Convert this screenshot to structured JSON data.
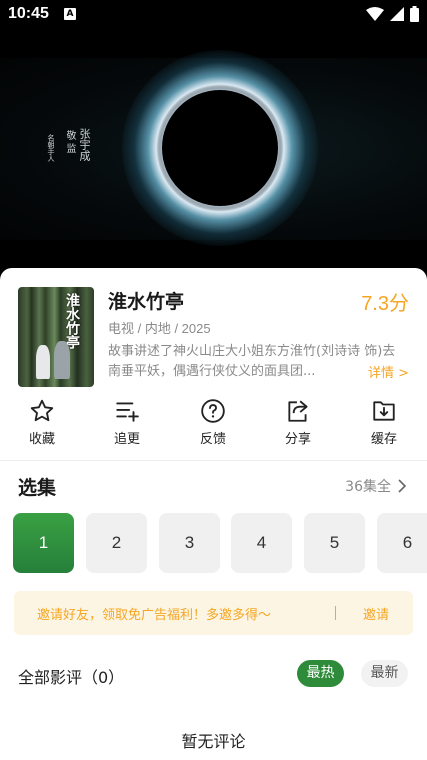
{
  "status_bar": {
    "time": "10:45",
    "notification_glyph": "A"
  },
  "video": {
    "poster_vertical_1": "张宇成",
    "poster_vertical_2": "敬  监",
    "poster_vertical_3": "名朝手人"
  },
  "show": {
    "cover_title": "淮水竹亭",
    "title": "淮水竹亭",
    "score": "7.3分",
    "meta": "电视 / 内地 / 2025",
    "description": "故事讲述了神火山庄大小姐东方淮竹(刘诗诗 饰)去南垂平妖，偶遇行侠仗义的面具团...",
    "more_label": "详情 >"
  },
  "actions": [
    {
      "label": "收藏",
      "icon": "star-icon"
    },
    {
      "label": "追更",
      "icon": "playlist-add-icon"
    },
    {
      "label": "反馈",
      "icon": "help-circle-icon"
    },
    {
      "label": "分享",
      "icon": "share-icon"
    },
    {
      "label": "缓存",
      "icon": "download-icon"
    }
  ],
  "episodes": {
    "header": "选集",
    "total": "36集全",
    "items": [
      "1",
      "2",
      "3",
      "4",
      "5",
      "6"
    ],
    "selected": "1"
  },
  "invite": {
    "text": "邀请好友，领取免广告福利！多邀多得～",
    "button": "邀请"
  },
  "reviews": {
    "title": "全部影评（0）",
    "sort_hot": "最热",
    "sort_new": "最新",
    "empty_text": "暂无评论"
  },
  "colors": {
    "accent_orange": "#f5a623",
    "accent_green": "#2e8b3a",
    "invite_bg": "#fdf5e3"
  }
}
